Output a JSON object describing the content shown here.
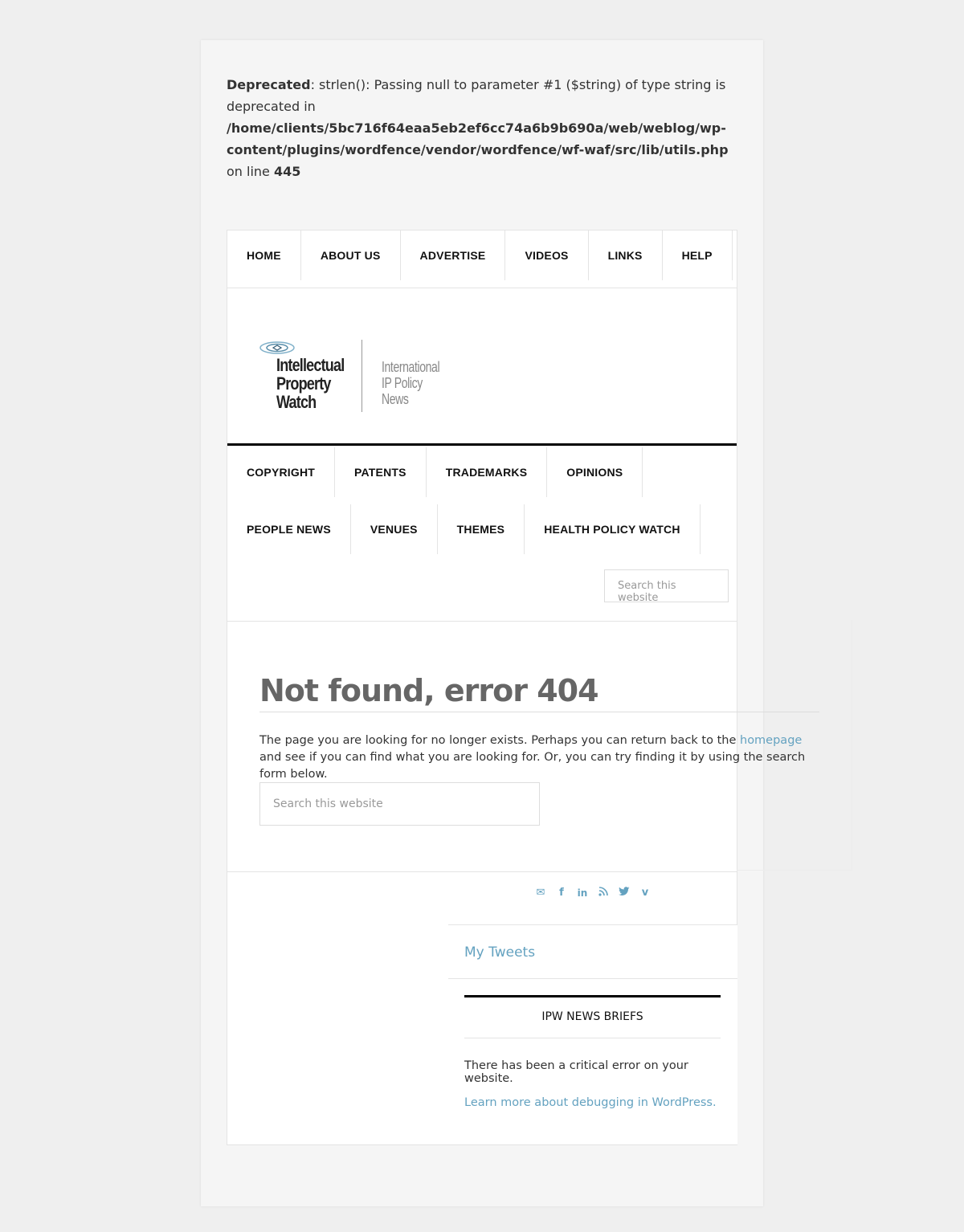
{
  "deprecated": {
    "label": "Deprecated",
    "message": ": strlen(): Passing null to parameter #1 ($string) of type string is deprecated in ",
    "path": "/home/clients/5bc716f64eaa5eb2ef6cc74a6b9b690a/web/weblog/wp-content/plugins/wordfence/vendor/wordfence/wf-waf/src/lib/utils.php",
    "on_line": " on line ",
    "line": "445"
  },
  "top_nav": [
    "HOME",
    "ABOUT US",
    "ADVERTISE",
    "VIDEOS",
    "LINKS",
    "HELP"
  ],
  "logo": {
    "name_line1": "Intellectual",
    "name_line2": "Property",
    "name_line3": "Watch",
    "tag_line1": "International",
    "tag_line2": "IP Policy News"
  },
  "main_nav": {
    "row1": [
      "COPYRIGHT",
      "PATENTS",
      "TRADEMARKS",
      "OPINIONS"
    ],
    "row2": [
      "PEOPLE NEWS",
      "VENUES",
      "THEMES",
      "HEALTH POLICY WATCH"
    ]
  },
  "search": {
    "header_placeholder": "Search this website",
    "main_placeholder": "Search this website"
  },
  "error": {
    "title": "Not found, error 404",
    "text_before": "The page you are looking for no longer exists. Perhaps you can return back to the ",
    "link": "homepage",
    "text_after": " and see if you can find what you are looking for. Or, you can try finding it by using the search form below."
  },
  "social_icons": [
    "email-icon",
    "facebook-icon",
    "linkedin-icon",
    "rss-icon",
    "twitter-icon",
    "vimeo-icon"
  ],
  "sidebar": {
    "tweets": "My Tweets",
    "briefs_title": "IPW NEWS BRIEFS",
    "briefs_error": "There has been a critical error on your website.",
    "briefs_link": "Learn more about debugging in WordPress."
  },
  "colors": {
    "link": "#64a2c0",
    "page_bg": "#efefef",
    "title": "#666666"
  }
}
